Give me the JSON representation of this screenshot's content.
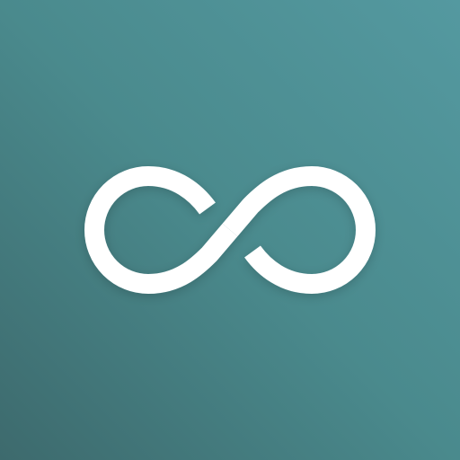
{
  "icon": {
    "name": "infinity-icon",
    "colors": {
      "background_top_right": "#5499a0",
      "background_mid": "#4a8a8d",
      "background_bottom_left": "#3d6a6d",
      "symbol": "#ffffff"
    }
  }
}
